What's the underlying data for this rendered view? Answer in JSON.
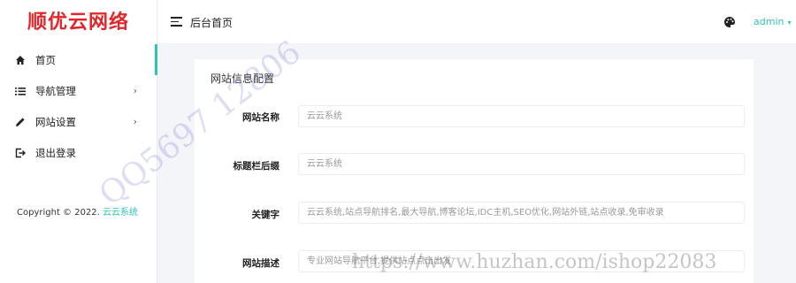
{
  "sidebar": {
    "logo": "顺优云网络",
    "items": [
      {
        "label": "首页",
        "icon": "home-icon",
        "active": true
      },
      {
        "label": "导航管理",
        "icon": "list-icon",
        "chevron": "›"
      },
      {
        "label": "网站设置",
        "icon": "pencil-icon",
        "chevron": "›"
      },
      {
        "label": "退出登录",
        "icon": "logout-icon"
      }
    ],
    "copyright_prefix": "Copyright © 2022.",
    "copyright_brand": "云云系统"
  },
  "header": {
    "title": "后台首页",
    "user": "admin",
    "caret": "▾"
  },
  "card": {
    "title": "网站信息配置",
    "fields": [
      {
        "label": "网站名称",
        "placeholder": "云云系统"
      },
      {
        "label": "标题栏后缀",
        "placeholder": "云云系统"
      },
      {
        "label": "关键字",
        "placeholder": "云云系统,站点导航排名,最大导航,博客论坛,IDC主机,SEO优化,网站外链,站点收录,免审收录"
      },
      {
        "label": "网站描述",
        "placeholder": "专业网站导航平台,提供站点点击出发"
      }
    ]
  },
  "watermarks": {
    "qq": "QQ5697 12806",
    "url": "https://www.huzhan.com/ishop22083"
  },
  "colors": {
    "accent": "#2ec4b6",
    "logo": "#e0282c"
  }
}
